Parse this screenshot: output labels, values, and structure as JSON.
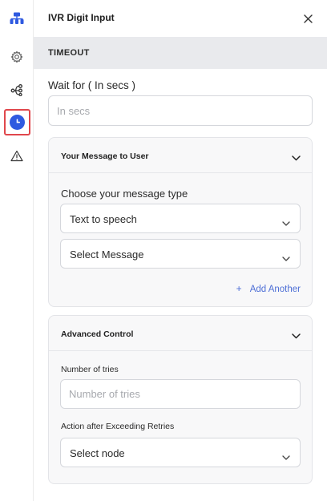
{
  "sidebar": {
    "items": [
      {
        "name": "flow-icon"
      },
      {
        "name": "gear-icon"
      },
      {
        "name": "branch-icon"
      },
      {
        "name": "clock-icon",
        "active": true
      },
      {
        "name": "warning-icon"
      }
    ],
    "accent_color": "#2f5ae0",
    "highlight_color": "#e0474c"
  },
  "panel": {
    "title": "IVR Digit Input",
    "section_title": "TIMEOUT",
    "wait": {
      "label": "Wait for ( In secs )",
      "placeholder": "In secs",
      "value": ""
    },
    "message_card": {
      "title": "Your Message to User",
      "type_label": "Choose your message type",
      "type_value": "Text to speech",
      "message_value": "Select Message",
      "add_another_label": "Add Another"
    },
    "advanced_card": {
      "title": "Advanced Control",
      "tries_label": "Number of tries",
      "tries_placeholder": "Number of tries",
      "tries_value": "",
      "action_label": "Action after Exceeding Retries",
      "action_value": "Select node"
    }
  }
}
